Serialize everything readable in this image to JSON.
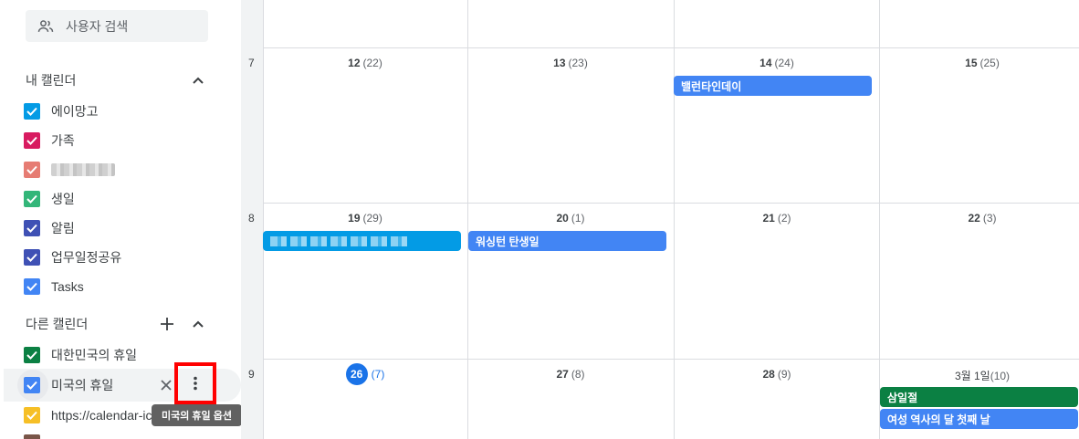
{
  "sidebar": {
    "search_users_label": "사용자 검색",
    "my_calendars": {
      "title": "내 캘린더",
      "items": [
        {
          "label": "에이망고",
          "color": "#039be5"
        },
        {
          "label": "가족",
          "color": "#d81b60"
        },
        {
          "label": "",
          "color": "#e67c73"
        },
        {
          "label": "생일",
          "color": "#33b679"
        },
        {
          "label": "알림",
          "color": "#3f51b5"
        },
        {
          "label": "업무일정공유",
          "color": "#3f51b5"
        },
        {
          "label": "Tasks",
          "color": "#4285f4"
        }
      ]
    },
    "other_calendars": {
      "title": "다른 캘린더",
      "items": [
        {
          "label": "대한민국의 휴일",
          "color": "#0b8043"
        },
        {
          "label": "미국의 휴일",
          "color": "#4285f4"
        },
        {
          "label": "https://calendar-ic",
          "color": "#f6bf26"
        }
      ]
    },
    "options_tooltip": "미국의 휴일 옵션"
  },
  "calendar": {
    "weeks": [
      {
        "week": "7",
        "days": [
          {
            "day": "12",
            "lunar": "(22)"
          },
          {
            "day": "13",
            "lunar": "(23)"
          },
          {
            "day": "14",
            "lunar": "(24)"
          },
          {
            "day": "15",
            "lunar": "(25)"
          }
        ]
      },
      {
        "week": "8",
        "days": [
          {
            "day": "19",
            "lunar": "(29)"
          },
          {
            "day": "20",
            "lunar": "(1)"
          },
          {
            "day": "21",
            "lunar": "(2)"
          },
          {
            "day": "22",
            "lunar": "(3)"
          }
        ]
      },
      {
        "week": "9",
        "days": [
          {
            "day": "26",
            "lunar": "(7)"
          },
          {
            "day": "27",
            "lunar": "(8)"
          },
          {
            "day": "28",
            "lunar": "(9)"
          },
          {
            "day": "3월 1일",
            "lunar": "(10)"
          }
        ]
      }
    ],
    "events": {
      "valentine": {
        "label": "밸런타인데이",
        "color": "#4285f4"
      },
      "blurred": {
        "label": "",
        "color": "#039be5"
      },
      "washington": {
        "label": "워싱턴 탄생일",
        "color": "#4285f4"
      },
      "samiljeol": {
        "label": "삼일절",
        "color": "#0b8043"
      },
      "womens_history": {
        "label": "여성 역사의 달 첫째 날",
        "color": "#4285f4"
      }
    }
  }
}
